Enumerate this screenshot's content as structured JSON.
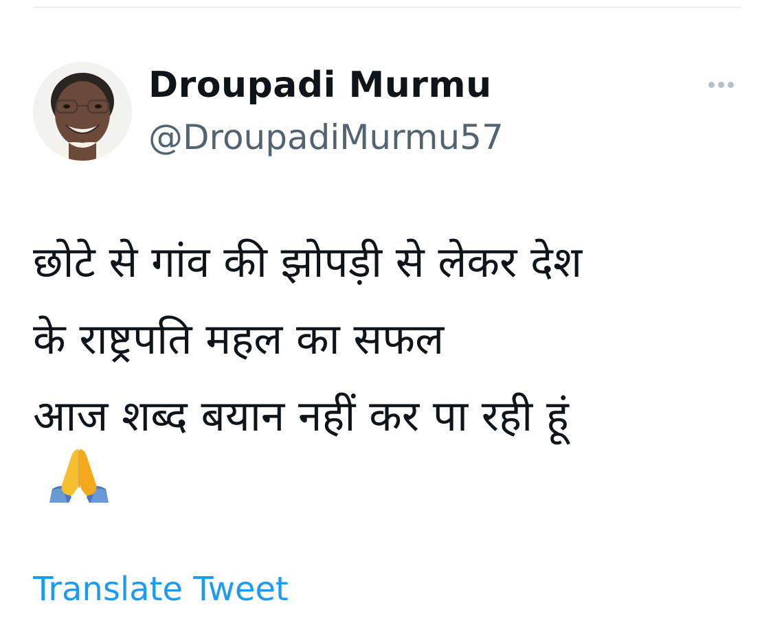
{
  "tweet": {
    "author": {
      "display_name": "Droupadi Murmu",
      "handle": "@DroupadiMurmu57"
    },
    "text_lines": [
      "छोटे से गांव की झोपड़ी से लेकर देश",
      "के राष्ट्रपति महल का सफल",
      "आज शब्द बयान नहीं कर पा रही हूं"
    ],
    "emoji": "🙏",
    "translate_label": "Translate Tweet"
  },
  "icons": {
    "more": "more-horizontal-icon",
    "emoji": "folded-hands-emoji"
  },
  "colors": {
    "text_primary": "#0f1419",
    "text_secondary": "#536471",
    "link": "#1d9bf0",
    "divider": "#e1e6ea",
    "more_dots": "#b7c0c8"
  }
}
